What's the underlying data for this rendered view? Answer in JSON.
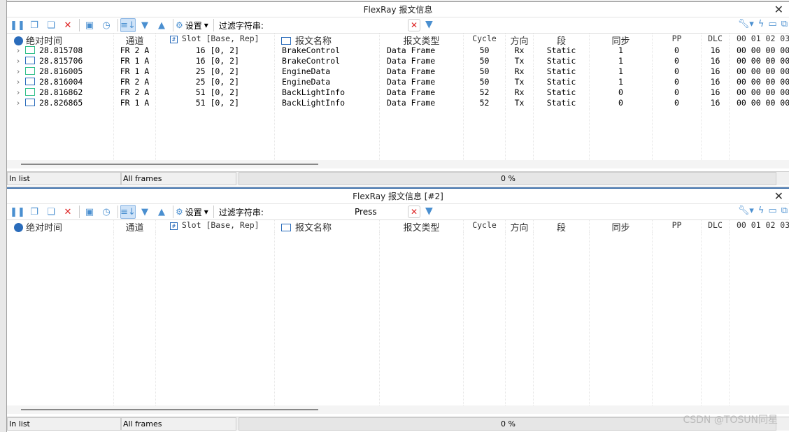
{
  "colors": {
    "accent": "#4a8fd0",
    "rx_icon": "#2fbf8a",
    "tx_icon": "#2a6cbb",
    "clear": "#d22222"
  },
  "toolbar": {
    "settings_label": "设置",
    "filter_label": "过滤字符串:"
  },
  "columns": [
    "绝对时间",
    "通道",
    "Slot [Base, Rep]",
    "报文名称",
    "报文类型",
    "Cycle",
    "方向",
    "段",
    "同步",
    "PP",
    "DLC",
    "00 01 02 03"
  ],
  "panels": [
    {
      "title": "FlexRay 报文信息",
      "filter_value": "",
      "rows": [
        {
          "time": "28.815708",
          "channel": "FR 2 A",
          "slot": "16 [0, 2]",
          "name": "BrakeControl",
          "type": "Data Frame",
          "cycle": "50",
          "dir": "Rx",
          "segment": "Static",
          "sync": "1",
          "pp": "0",
          "dlc": "16",
          "data": "00 00 00 00"
        },
        {
          "time": "28.815706",
          "channel": "FR 1 A",
          "slot": "16 [0, 2]",
          "name": "BrakeControl",
          "type": "Data Frame",
          "cycle": "50",
          "dir": "Tx",
          "segment": "Static",
          "sync": "1",
          "pp": "0",
          "dlc": "16",
          "data": "00 00 00 00"
        },
        {
          "time": "28.816005",
          "channel": "FR 1 A",
          "slot": "25 [0, 2]",
          "name": "EngineData",
          "type": "Data Frame",
          "cycle": "50",
          "dir": "Rx",
          "segment": "Static",
          "sync": "1",
          "pp": "0",
          "dlc": "16",
          "data": "00 00 00 00"
        },
        {
          "time": "28.816004",
          "channel": "FR 2 A",
          "slot": "25 [0, 2]",
          "name": "EngineData",
          "type": "Data Frame",
          "cycle": "50",
          "dir": "Tx",
          "segment": "Static",
          "sync": "1",
          "pp": "0",
          "dlc": "16",
          "data": "00 00 00 00"
        },
        {
          "time": "28.816862",
          "channel": "FR 2 A",
          "slot": "51 [0, 2]",
          "name": "BackLightInfo",
          "type": "Data Frame",
          "cycle": "52",
          "dir": "Rx",
          "segment": "Static",
          "sync": "0",
          "pp": "0",
          "dlc": "16",
          "data": "00 00 00 00"
        },
        {
          "time": "28.826865",
          "channel": "FR 1 A",
          "slot": "51 [0, 2]",
          "name": "BackLightInfo",
          "type": "Data Frame",
          "cycle": "52",
          "dir": "Tx",
          "segment": "Static",
          "sync": "0",
          "pp": "0",
          "dlc": "16",
          "data": "00 00 00 00"
        }
      ],
      "status": {
        "list": "In list",
        "frames": "All frames",
        "progress": "0 %",
        "progress_value": 0
      }
    },
    {
      "title": "FlexRay 报文信息 [#2]",
      "filter_value": "Press",
      "rows": [],
      "status": {
        "list": "In list",
        "frames": "All frames",
        "progress": "0 %",
        "progress_value": 0
      }
    }
  ],
  "watermark": "CSDN @TOSUN同星"
}
